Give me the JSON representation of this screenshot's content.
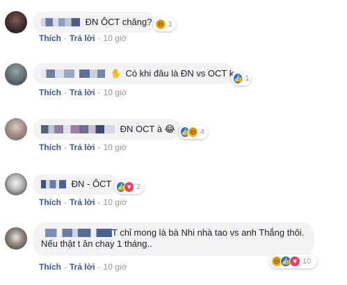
{
  "colors": {
    "bubble_bg": "#f2f3f5",
    "link": "#385898",
    "like": "#1877f2",
    "haha": "#f7b125",
    "love": "#f33e58"
  },
  "comments": [
    {
      "text": "ĐN ÔCT chăng?",
      "actions": {
        "like": "Thích",
        "reply": "Trả lời",
        "time": "10 giờ"
      },
      "reactions": {
        "icons": [
          "haha-icon"
        ],
        "count": "1"
      }
    },
    {
      "text": "Có khi đâu là ĐN vs OCT k",
      "actions": {
        "like": "Thích",
        "reply": "Trả lời",
        "time": "10 giờ"
      },
      "reactions": {
        "icons": [
          "like-icon"
        ],
        "count": "1"
      }
    },
    {
      "text": "ĐN OCT à 😂",
      "actions": {
        "like": "Thích",
        "reply": "Trả lời",
        "time": "10 giờ"
      },
      "reactions": {
        "icons": [
          "like-icon",
          "haha-icon"
        ],
        "count": "4"
      }
    },
    {
      "text": "ĐN - ÔCT",
      "actions": {
        "like": "Thích",
        "reply": "Trả lời",
        "time": "10 giờ"
      },
      "reactions": {
        "icons": [
          "like-icon",
          "love-icon"
        ],
        "count": "2"
      }
    },
    {
      "text": "T chỉ mong là bà Nhi nhà tao vs anh Thắng thôi. Nếu thật t ăn chay 1 tháng..",
      "actions": {
        "like": "Thích",
        "reply": "Trả lời",
        "time": "10 giờ"
      },
      "reactions": {
        "icons": [
          "haha-icon",
          "like-icon",
          "love-icon"
        ],
        "count": "10"
      }
    }
  ]
}
